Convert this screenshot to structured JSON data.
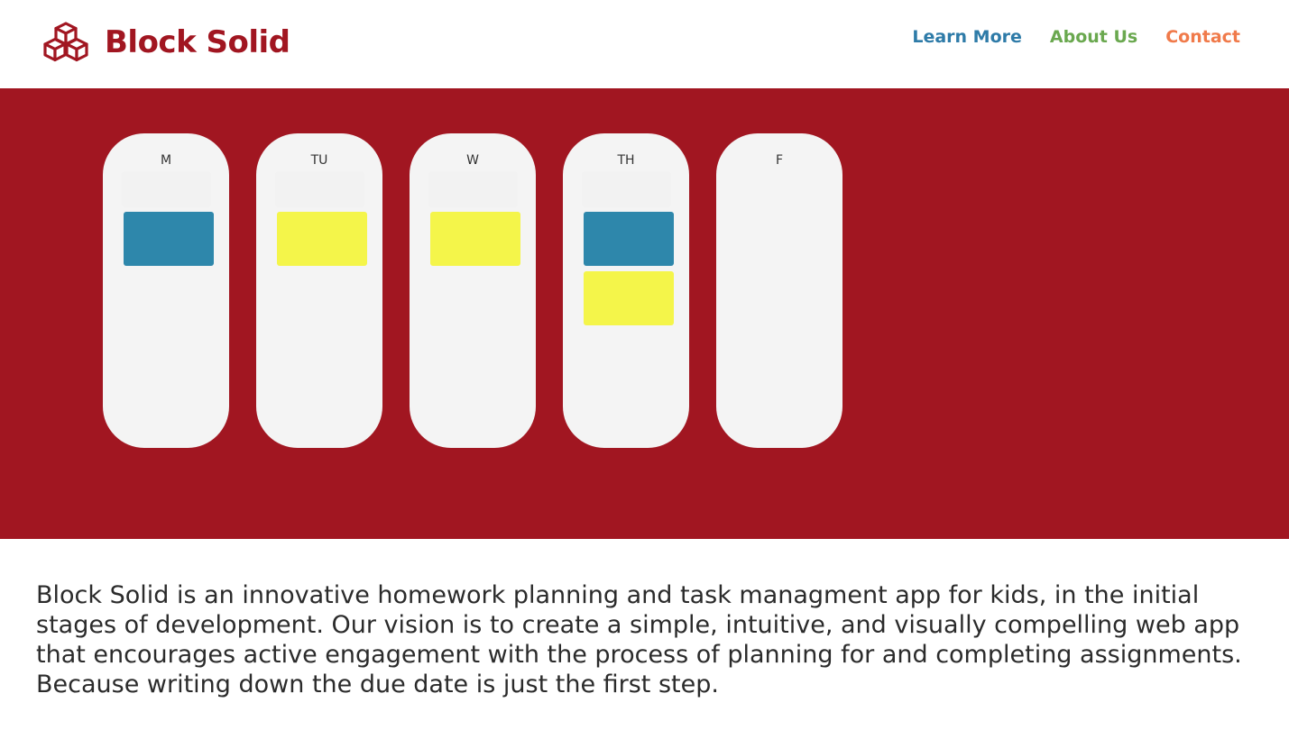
{
  "colors": {
    "brand": "#a11621",
    "task_blue": "#2e87ab",
    "task_yellow": "#f4f54a"
  },
  "header": {
    "logo_icon": "stacked-blocks-icon",
    "brand_name": "Block Solid",
    "nav": [
      {
        "label": "Learn More",
        "color": "#2e7ba8"
      },
      {
        "label": "About Us",
        "color": "#6aa84f"
      },
      {
        "label": "Contact",
        "color": "#f07a4a"
      }
    ]
  },
  "planner": {
    "days": [
      {
        "label": "M",
        "tasks": [
          "blue"
        ]
      },
      {
        "label": "TU",
        "tasks": [
          "yellow"
        ]
      },
      {
        "label": "W",
        "tasks": [
          "yellow"
        ]
      },
      {
        "label": "TH",
        "tasks": [
          "blue",
          "yellow"
        ]
      },
      {
        "label": "F",
        "tasks": []
      }
    ]
  },
  "description": "Block Solid is an innovative homework planning and task managment app for kids, in the initial stages of development. Our vision is to create a simple, intuitive, and visually compelling web app that encourages active engagement with the process of planning for and completing assignments. Because writing down the due date is just the first step."
}
